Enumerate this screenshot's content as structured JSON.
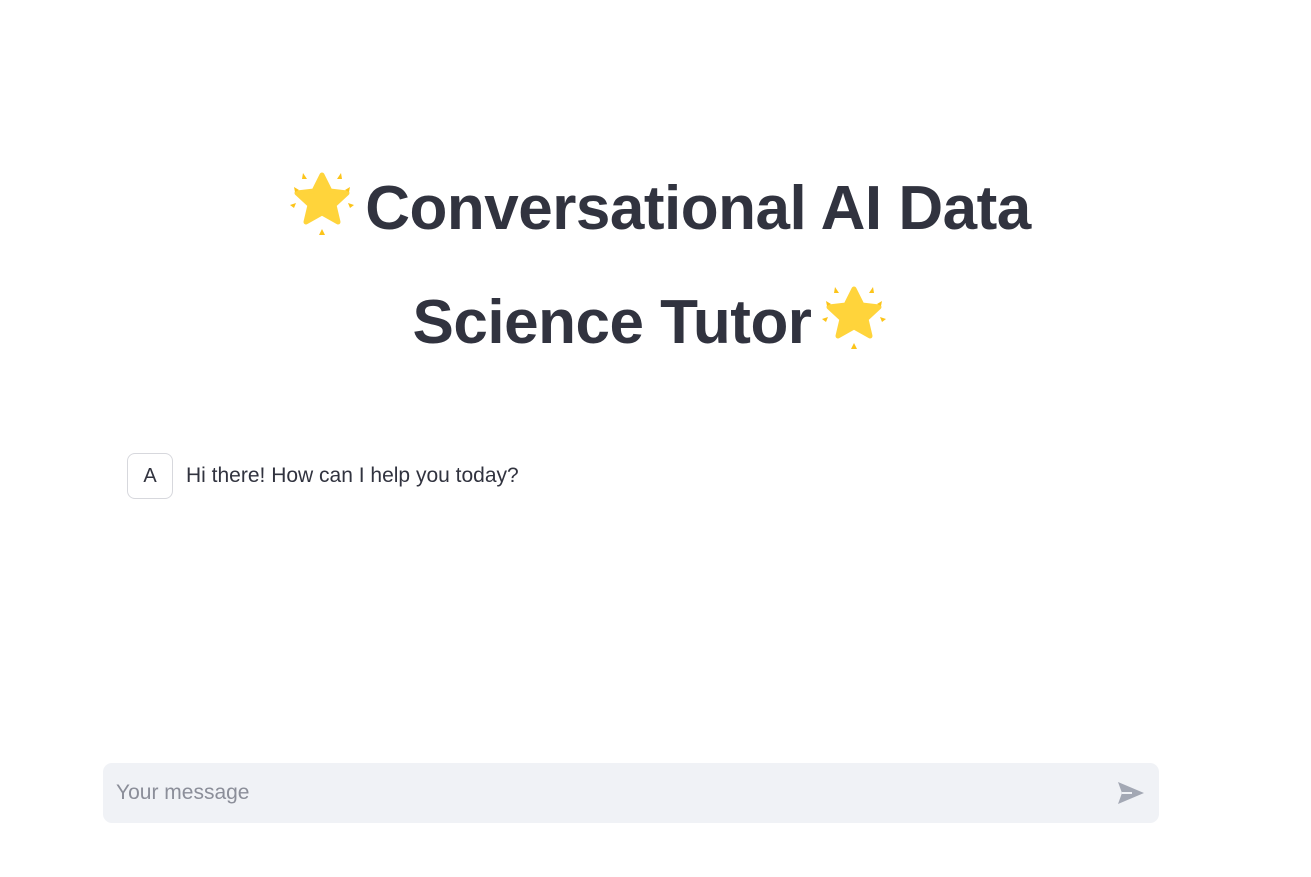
{
  "header": {
    "title_part1": "Conversational AI Data",
    "title_part2": "Science Tutor",
    "title_icon": "glowing-star-icon"
  },
  "chat": {
    "messages": [
      {
        "role": "assistant",
        "avatar_label": "A",
        "text": "Hi there! How can I help you today?"
      }
    ]
  },
  "input": {
    "placeholder": "Your message",
    "value": "",
    "send_icon": "send-arrow-icon"
  },
  "colors": {
    "text": "#31333f",
    "input_bg": "#f0f2f6",
    "star": "#ffd43b",
    "send_icon": "#a3a8b4"
  }
}
